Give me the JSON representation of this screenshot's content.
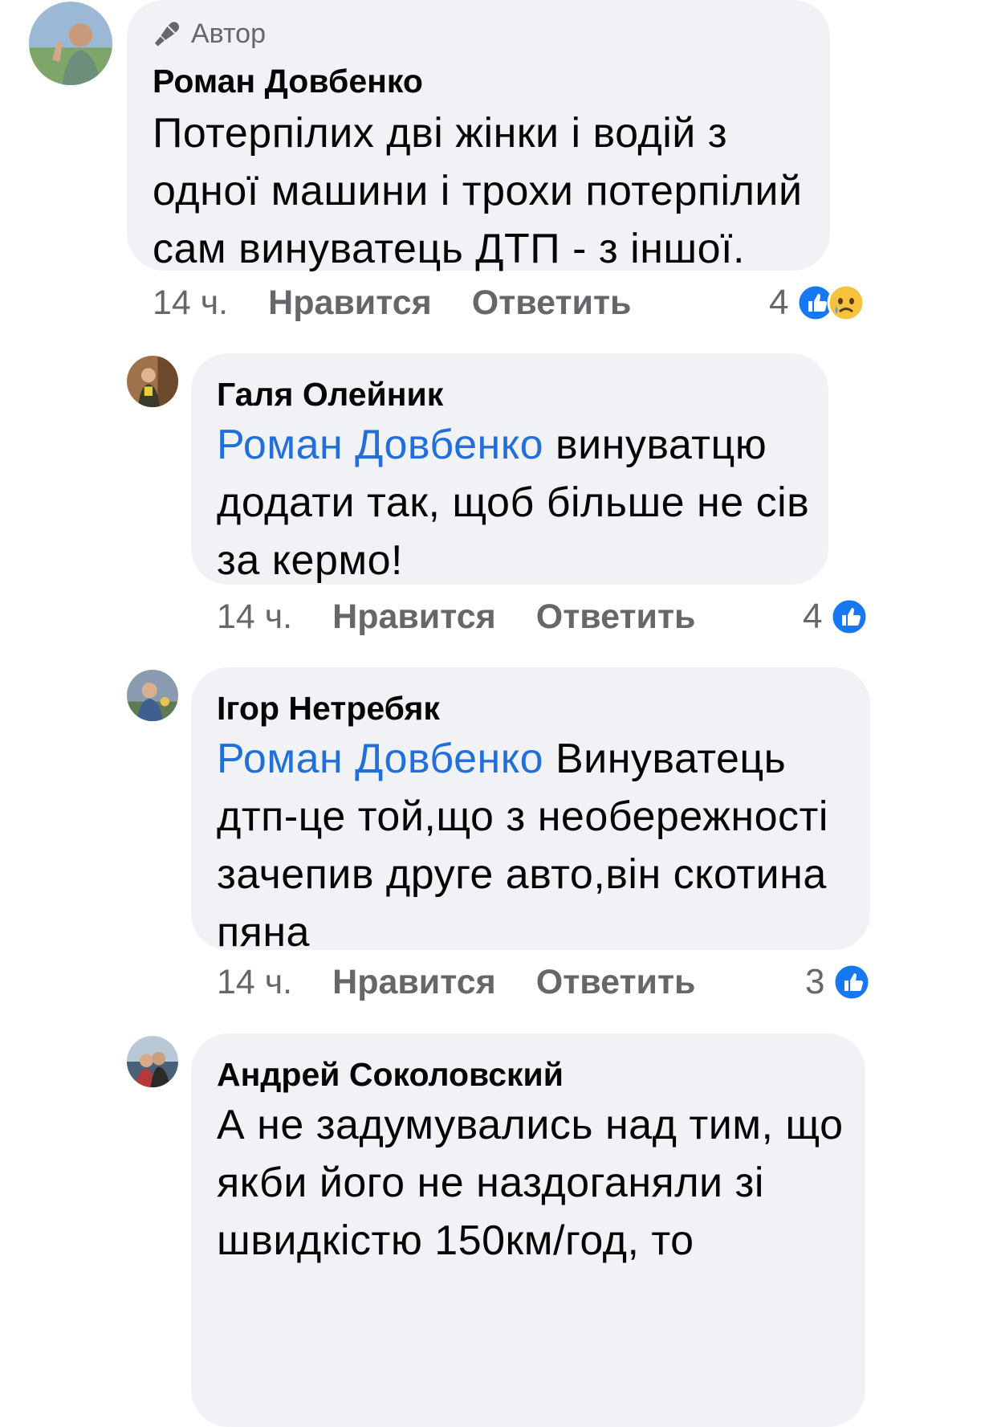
{
  "comments": [
    {
      "author_badge": "Автор",
      "name": "Роман Довбенко",
      "mention": "",
      "text": "Потерпілих дві жінки і водій з одної машини і трохи потерпілий сам винуватець ДТП - з іншої.",
      "time": "14 ч.",
      "like": "Нравится",
      "reply": "Ответить",
      "reactions": "4",
      "reaction_icons": [
        "like-icon",
        "sad-icon"
      ]
    },
    {
      "name": "Галя Олейник",
      "mention": "Роман Довбенко",
      "text": " винуватцю додати так, щоб більше не сів за кермо!",
      "time": "14 ч.",
      "like": "Нравится",
      "reply": "Ответить",
      "reactions": "4",
      "reaction_icons": [
        "like-icon"
      ]
    },
    {
      "name": "Ігор Нетребяк",
      "mention": "Роман Довбенко",
      "text": " Винуватець дтп-це той,що з необережності зачепив друге авто,він скотина пяна",
      "time": "14 ч.",
      "like": "Нравится",
      "reply": "Ответить",
      "reactions": "3",
      "reaction_icons": [
        "like-icon"
      ]
    },
    {
      "name": "Андрей Соколовский",
      "mention": "",
      "text": "А не задумувались над тим, що якби його не наздоганяли зі швидкістю 150км/год, то"
    }
  ],
  "colors": {
    "bubble": "#f0f2f5",
    "mention": "#216fdb",
    "muted": "#65676b",
    "like_blue": "#1877f2"
  }
}
